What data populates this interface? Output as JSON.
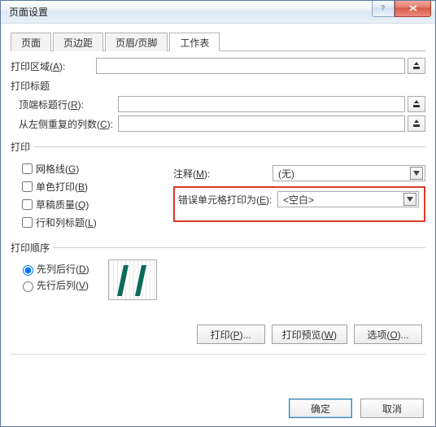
{
  "window": {
    "title": "页面设置"
  },
  "tabs": {
    "page": "页面",
    "margins": "页边距",
    "header_footer": "页眉/页脚",
    "sheet": "工作表"
  },
  "print_area": {
    "label_pre": "打印区域(",
    "label_key": "A",
    "label_post": "):",
    "value": ""
  },
  "print_titles": {
    "heading": "打印标题",
    "rows": {
      "label_pre": "顶端标题行(",
      "label_key": "R",
      "label_post": "):",
      "value": ""
    },
    "cols": {
      "label_pre": "从左侧重复的列数(",
      "label_key": "C",
      "label_post": "):",
      "value": ""
    }
  },
  "print": {
    "legend": "打印",
    "gridlines": {
      "pre": "网格线(",
      "key": "G",
      "post": ")"
    },
    "bw": {
      "pre": "单色打印(",
      "key": "B",
      "post": ")"
    },
    "draft": {
      "pre": "草稿质量(",
      "key": "Q",
      "post": ")"
    },
    "headings": {
      "pre": "行和列标题(",
      "key": "L",
      "post": ")"
    },
    "comments_label": {
      "pre": "注释(",
      "key": "M",
      "post": "):"
    },
    "comments_value": "(无)",
    "errors_label": {
      "pre": "错误单元格打印为(",
      "key": "E",
      "post": "):"
    },
    "errors_value": "<空白>"
  },
  "order": {
    "legend": "打印顺序",
    "down_then_over": {
      "pre": "先列后行(",
      "key": "D",
      "post": ")"
    },
    "over_then_down": {
      "pre": "先行后列(",
      "key": "V",
      "post": ")"
    }
  },
  "buttons": {
    "print": {
      "pre": "打印(",
      "key": "P",
      "post": ")..."
    },
    "preview": {
      "pre": "打印预览(",
      "key": "W",
      "post": ")"
    },
    "options": {
      "pre": "选项(",
      "key": "O",
      "post": ")..."
    },
    "ok": "确定",
    "cancel": "取消"
  }
}
